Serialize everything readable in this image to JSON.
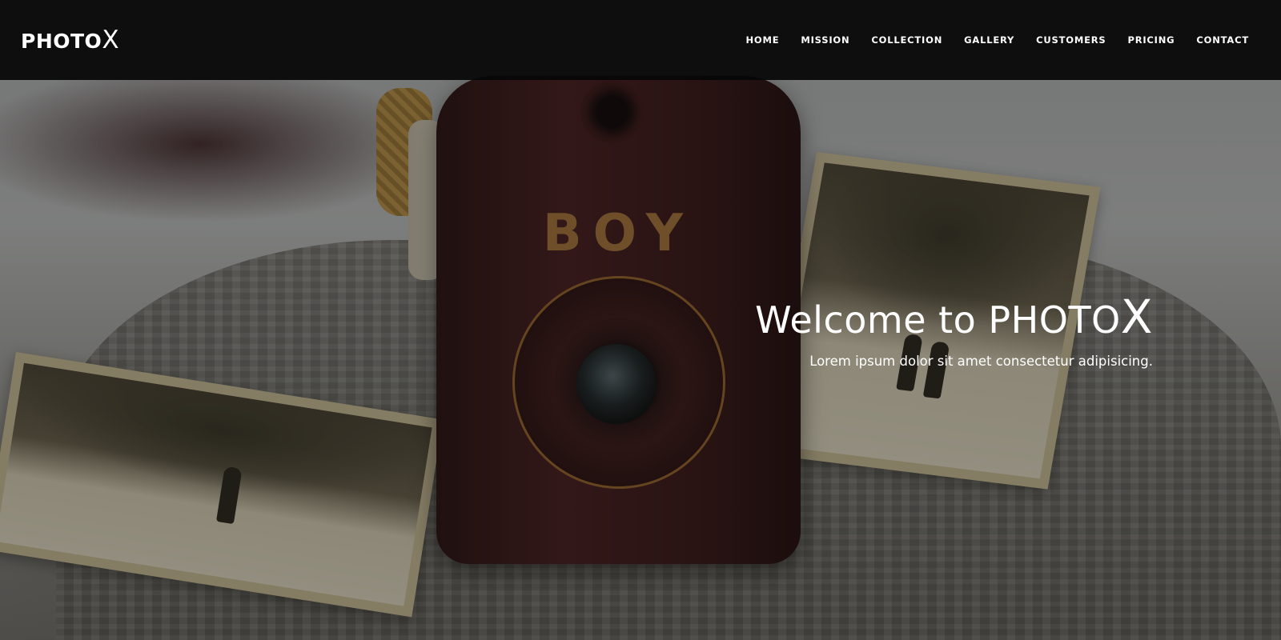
{
  "brand": {
    "name_main": "PHOTO",
    "name_accent": "X"
  },
  "nav": {
    "items": [
      {
        "label": "HOME"
      },
      {
        "label": "MISSION"
      },
      {
        "label": "COLLECTION"
      },
      {
        "label": "GALLERY"
      },
      {
        "label": "CUSTOMERS"
      },
      {
        "label": "PRICING"
      },
      {
        "label": "CONTACT"
      }
    ]
  },
  "hero": {
    "title_main": "Welcome to PHOTO",
    "title_accent": "X",
    "subtitle": "Lorem ipsum dolor sit amet consectetur adipisicing.",
    "camera_brand": "BOY"
  },
  "colors": {
    "navbar_bg": "#060606",
    "text": "#ffffff",
    "camera_body": "#3b1518",
    "camera_accent": "#b07a3f"
  }
}
